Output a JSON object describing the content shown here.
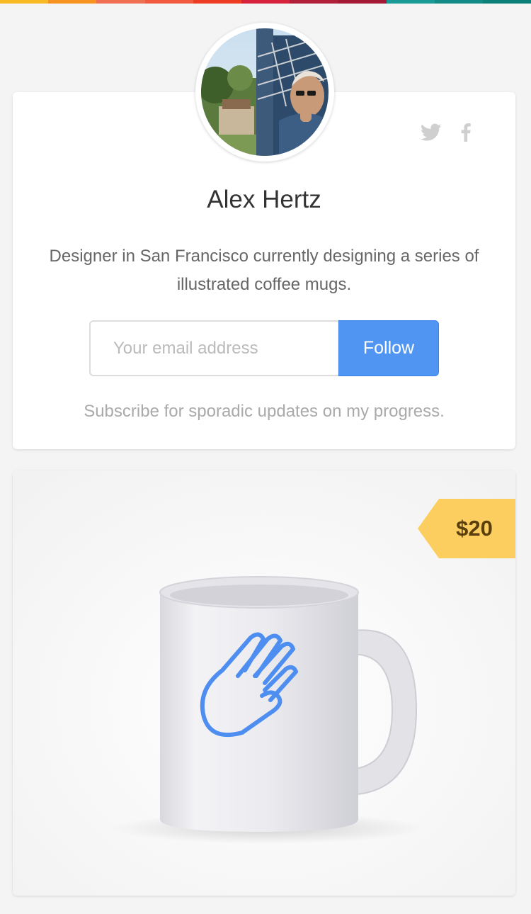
{
  "colors": {
    "stripe": [
      "#f9b924",
      "#f6921e",
      "#ef6f52",
      "#f15a3e",
      "#ee3b24",
      "#d6223d",
      "#b21f3a",
      "#a31a34",
      "#1a9a96",
      "#128a86",
      "#0c7f79"
    ],
    "follow_button": "#5195f3",
    "price_tag": "#fccd5f"
  },
  "profile": {
    "avatar_alt": "Profile photo",
    "name": "Alex Hertz",
    "bio": "Designer in San Francisco currently designing a series of illustrated coffee mugs.",
    "social": {
      "twitter_icon": "twitter-icon",
      "facebook_icon": "facebook-icon"
    }
  },
  "subscribe": {
    "email_placeholder": "Your email address",
    "email_value": "",
    "button_label": "Follow",
    "note": "Subscribe for sporadic updates on my progress."
  },
  "product": {
    "image_alt": "White coffee mug with blue hand illustration",
    "price": "$20"
  }
}
